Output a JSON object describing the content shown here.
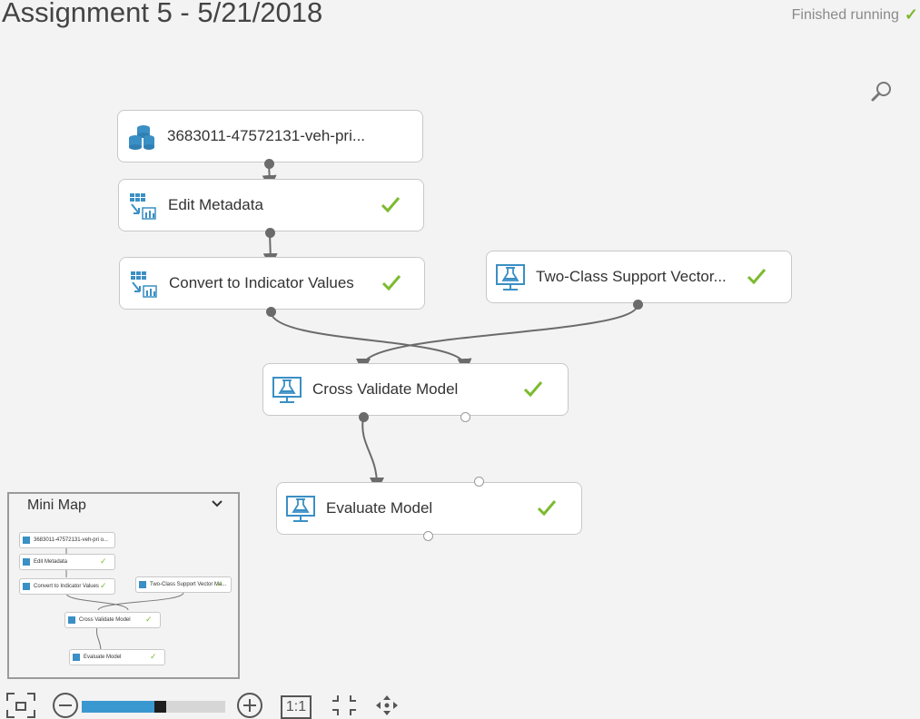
{
  "header": {
    "title": "Assignment 5 - 5/21/2018",
    "status": "Finished running",
    "status_icon": "check-icon"
  },
  "colors": {
    "accent": "#3a98d0",
    "success": "#7cba2f",
    "node_icon": "#3a8fc4",
    "port": "#6b6b6b"
  },
  "nodes": {
    "dataset": {
      "label": "3683011-47572131-veh-pri...",
      "icon": "dataset-icon",
      "status": ""
    },
    "edit_metadata": {
      "label": "Edit Metadata",
      "icon": "table-transform-icon",
      "status": "complete"
    },
    "convert_indicator": {
      "label": "Convert to Indicator Values",
      "icon": "table-transform-icon",
      "status": "complete"
    },
    "svm": {
      "label": "Two-Class Support Vector...",
      "icon": "model-flask-icon",
      "status": "complete"
    },
    "cross_validate": {
      "label": "Cross Validate Model",
      "icon": "model-flask-icon",
      "status": "complete"
    },
    "evaluate": {
      "label": "Evaluate Model",
      "icon": "model-flask-icon",
      "status": "complete"
    }
  },
  "minimap": {
    "title": "Mini Map",
    "nodes": {
      "dataset": "3683011-47572131-veh-pri o...",
      "edit_metadata": "Edit Metadata",
      "convert_indicator": "Convert to Indicator Values",
      "svm": "Two-Class Support Vector Ma...",
      "cross_validate": "Cross Validate Model",
      "evaluate": "Evaluate Model"
    }
  },
  "toolbar": {
    "fit_icon": "fit-to-screen-icon",
    "zoom_out_icon": "zoom-out-icon",
    "zoom_in_icon": "zoom-in-icon",
    "actual_size_label": "1:1",
    "center_icon": "center-icon",
    "pan_icon": "pan-icon",
    "zoom_level": 0.55
  },
  "search": {
    "icon": "search-icon"
  }
}
